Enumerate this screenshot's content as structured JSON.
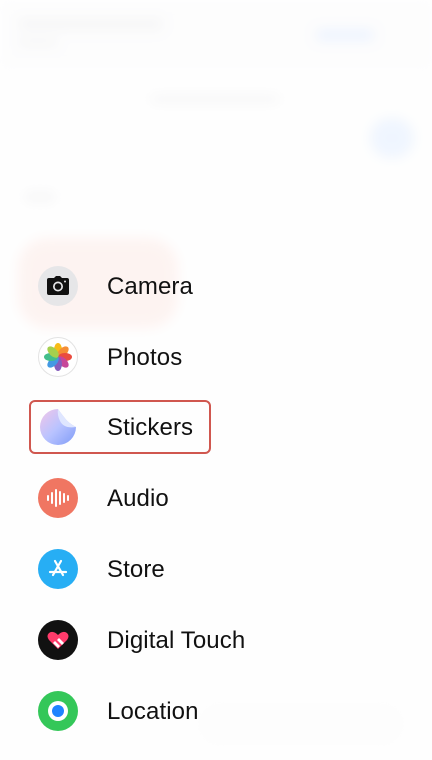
{
  "menu": {
    "items": [
      {
        "label": "Camera",
        "icon": "camera-icon",
        "color": "#e6e6e8"
      },
      {
        "label": "Photos",
        "icon": "photos-icon",
        "color": "#ffffff"
      },
      {
        "label": "Stickers",
        "icon": "stickers-icon",
        "color": "#dfe3ff",
        "highlighted": true
      },
      {
        "label": "Audio",
        "icon": "audio-waveform-icon",
        "color": "#f07662"
      },
      {
        "label": "Store",
        "icon": "app-store-icon",
        "color": "#27aef4"
      },
      {
        "label": "Digital Touch",
        "icon": "digital-touch-icon",
        "color": "#111111"
      },
      {
        "label": "Location",
        "icon": "location-icon",
        "color": "#34c759"
      }
    ]
  },
  "colors": {
    "highlight_border": "#d0574f"
  }
}
